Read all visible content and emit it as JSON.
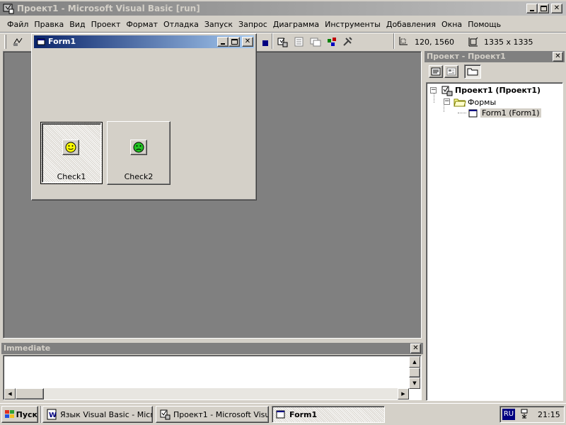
{
  "window": {
    "title": "Проект1 - Microsoft Visual Basic [run]"
  },
  "menu": [
    {
      "label": "Файл"
    },
    {
      "label": "Правка"
    },
    {
      "label": "Вид"
    },
    {
      "label": "Проект"
    },
    {
      "label": "Формат"
    },
    {
      "label": "Отладка"
    },
    {
      "label": "Запуск"
    },
    {
      "label": "Запрос"
    },
    {
      "label": "Диаграмма"
    },
    {
      "label": "Инструменты"
    },
    {
      "label": "Добавления"
    },
    {
      "label": "Окна"
    },
    {
      "label": "Помощь"
    }
  ],
  "toolbar": {
    "position": "120, 1560",
    "size": "1335 x 1335"
  },
  "form": {
    "title": "Form1",
    "check1": {
      "label": "Check1",
      "state": "pressed",
      "icon": "smiley-happy-icon"
    },
    "check2": {
      "label": "Check2",
      "state": "normal",
      "icon": "smiley-sad-icon"
    }
  },
  "project_panel": {
    "title": "Проект - Проект1",
    "tree": {
      "root": "Проект1 (Проект1)",
      "folder": "Формы",
      "item": "Form1 (Form1)"
    }
  },
  "immediate": {
    "title": "Immediate",
    "content": ""
  },
  "taskbar": {
    "start": "Пуск",
    "tasks": [
      {
        "label": "Язык Visual Basic - Micro..."
      },
      {
        "label": "Проект1 - Microsoft Visu..."
      },
      {
        "label": "Form1"
      }
    ],
    "lang": "RU",
    "clock": "21:15"
  },
  "colors": {
    "title_active": "#0a246a",
    "title_gradient": "#a6caf0",
    "title_inactive": "#808080",
    "workspace": "#808080"
  }
}
